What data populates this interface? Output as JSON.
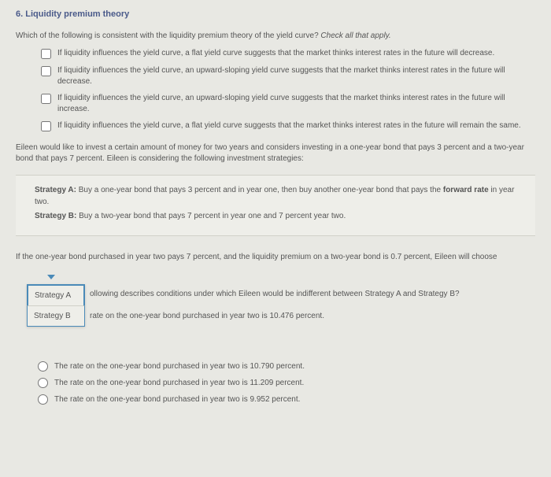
{
  "question_number": "6.",
  "question_title": "Liquidity premium theory",
  "prompt_text": "Which of the following is consistent with the liquidity premium theory of the yield curve?",
  "prompt_hint": "Check all that apply.",
  "checkboxes": [
    "If liquidity influences the yield curve, a flat yield curve suggests that the market thinks interest rates in the future will decrease.",
    "If liquidity influences the yield curve, an upward-sloping yield curve suggests that the market thinks interest rates in the future will decrease.",
    "If liquidity influences the yield curve, an upward-sloping yield curve suggests that the market thinks interest rates in the future will increase.",
    "If liquidity influences the yield curve, a flat yield curve suggests that the market thinks interest rates in the future will remain the same."
  ],
  "scenario": "Eileen would like to invest a certain amount of money for two years and considers investing in a one-year bond that pays 3 percent and a two-year bond that pays 7 percent. Eileen is considering the following investment strategies:",
  "strategies": {
    "a_label": "Strategy A:",
    "a_text": " Buy a one-year bond that pays 3 percent and in year one, then buy another one-year bond that pays the ",
    "a_bold": "forward rate",
    "a_tail": " in year two.",
    "b_label": "Strategy B:",
    "b_text": " Buy a two-year bond that pays 7 percent in year one and 7 percent year two."
  },
  "fill_prompt": "If the one-year bond purchased in year two pays 7 percent, and the liquidity premium on a two-year bond is 0.7 percent, Eileen will choose",
  "dropdown": {
    "opt_a": "Strategy A",
    "opt_b": "Strategy B"
  },
  "beside1": "ollowing describes conditions under which Eileen would be indifferent between Strategy A and Strategy B?",
  "beside2": "rate on the one-year bond purchased in year two is 10.476 percent.",
  "radios": [
    "The rate on the one-year bond purchased in year two is 10.790 percent.",
    "The rate on the one-year bond purchased in year two is 11.209 percent.",
    "The rate on the one-year bond purchased in year two is 9.952 percent."
  ]
}
